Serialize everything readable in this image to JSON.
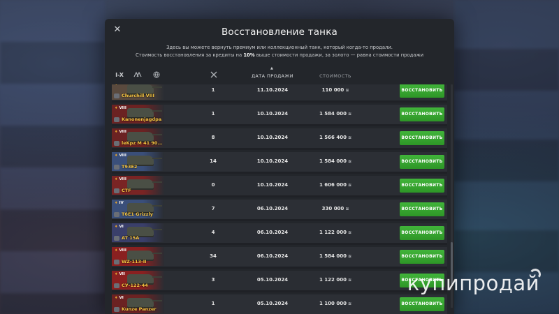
{
  "dialog": {
    "close_label": "✕",
    "title": "Восстановление танка",
    "desc_line1": "Здесь вы можете вернуть премиум или коллекционный танк, который когда-то продали.",
    "desc_line2_pre": "Стоимость восстановления за кредиты на ",
    "desc_line2_bold": "10%",
    "desc_line2_post": " выше стоимости продажи, за золото — равна стоимости продажи"
  },
  "columns": {
    "tier_filter": "I-X",
    "date": "ДАТА ПРОДАЖИ",
    "cost": "СТОИМОСТЬ"
  },
  "icons": {
    "type_filter": "vehicle-type-icon",
    "nation_filter": "globe-icon",
    "count": "crossed-swords-icon",
    "credits": "credits-icon"
  },
  "restore_label": "ВОССТАНОВИТЬ",
  "rows": [
    {
      "tier": "",
      "name": "Churchill VIII",
      "count": "1",
      "date": "11.10.2024",
      "cost": "110 000",
      "flag": "#5a4a3e"
    },
    {
      "tier": "VIII",
      "name": "Kanonenjagdpa...",
      "count": "1",
      "date": "10.10.2024",
      "cost": "1 584 000",
      "flag": "#6b2222"
    },
    {
      "tier": "VIII",
      "name": "leKpz M 41 90...",
      "count": "8",
      "date": "10.10.2024",
      "cost": "1 566 400",
      "flag": "#6b2222"
    },
    {
      "tier": "VIII",
      "name": "T93E2",
      "count": "14",
      "date": "10.10.2024",
      "cost": "1 584 000",
      "flag": "#3a4f7a"
    },
    {
      "tier": "VIII",
      "name": "CTF",
      "count": "0",
      "date": "10.10.2024",
      "cost": "1 606 000",
      "flag": "#7a2424"
    },
    {
      "tier": "IV",
      "name": "T6E1 Grizzly",
      "count": "7",
      "date": "06.10.2024",
      "cost": "330 000",
      "flag": "#3a4f7a"
    },
    {
      "tier": "VI",
      "name": "AT 15A",
      "count": "4",
      "date": "06.10.2024",
      "cost": "1 122 000",
      "flag": "#3a3f6a"
    },
    {
      "tier": "VIII",
      "name": "WZ-113-II",
      "count": "34",
      "date": "06.10.2024",
      "cost": "1 584 000",
      "flag": "#8a2020"
    },
    {
      "tier": "VII",
      "name": "СУ-122-44",
      "count": "3",
      "date": "05.10.2024",
      "cost": "1 122 000",
      "flag": "#8a2020"
    },
    {
      "tier": "VI",
      "name": "Kunze Panzer",
      "count": "1",
      "date": "05.10.2024",
      "cost": "1 100 000",
      "flag": "#6b2222"
    }
  ],
  "watermark": "купипродай"
}
